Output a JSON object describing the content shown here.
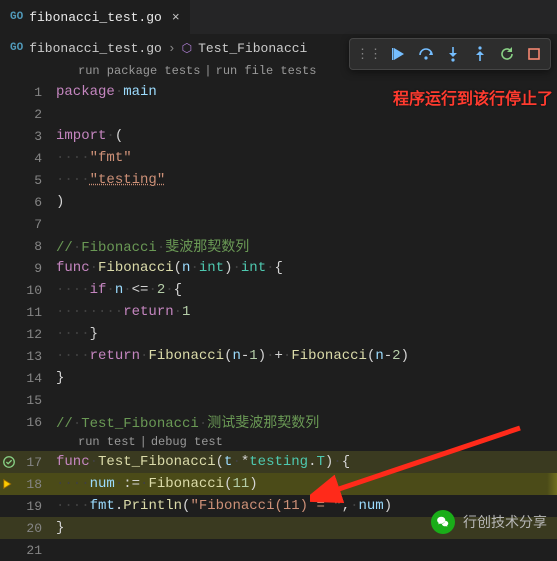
{
  "tab": {
    "filename": "fibonacci_test.go",
    "close": "×",
    "icon": "GO"
  },
  "breadcrumb": {
    "file": "fibonacci_test.go",
    "symbol": "Test_Fibonacci",
    "sep": "›",
    "icon": "GO"
  },
  "debug_toolbar": {
    "continue": "Continue",
    "step_over": "Step Over",
    "step_into": "Step Into",
    "step_out": "Step Out",
    "restart": "Restart",
    "stop": "Stop"
  },
  "codelens_top": {
    "left": "run package tests",
    "right": "run file tests",
    "divider": "|"
  },
  "codelens_test": {
    "left": "run test",
    "right": "debug test",
    "divider": "|"
  },
  "annotation": "程序运行到该行停止了",
  "watermark": "行创技术分享",
  "lines": {
    "l1": "package main",
    "l2": "",
    "l3": "import (",
    "l4": "    \"fmt\"",
    "l5": "    \"testing\"",
    "l6": ")",
    "l7": "",
    "l8": "// Fibonacci 斐波那契数列",
    "l9": "func Fibonacci(n int) int {",
    "l10": "    if n <= 2 {",
    "l11": "        return 1",
    "l12": "    }",
    "l13": "    return Fibonacci(n-1) + Fibonacci(n-2)",
    "l14": "}",
    "l15": "",
    "l16": "// Test_Fibonacci 测试斐波那契数列",
    "l17": "func Test_Fibonacci(t *testing.T) {",
    "l18": "    num := Fibonacci(11)",
    "l19": "    fmt.Println(\"Fibonacci(11) = \", num)",
    "l20": "}",
    "l21": ""
  },
  "line_numbers": {
    "n1": "1",
    "n2": "2",
    "n3": "3",
    "n4": "4",
    "n5": "5",
    "n6": "6",
    "n7": "7",
    "n8": "8",
    "n9": "9",
    "n10": "10",
    "n11": "11",
    "n12": "12",
    "n13": "13",
    "n14": "14",
    "n15": "15",
    "n16": "16",
    "n17": "17",
    "n18": "18",
    "n19": "19",
    "n20": "20",
    "n21": "21"
  }
}
